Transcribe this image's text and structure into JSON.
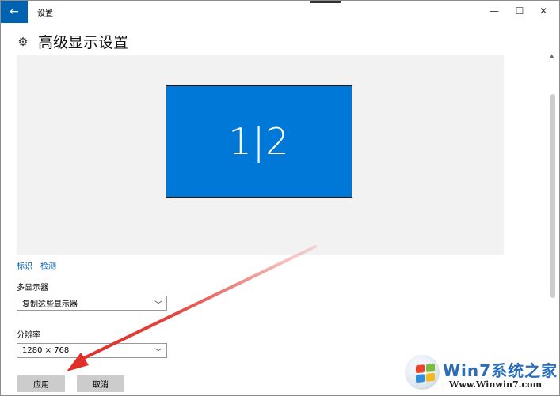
{
  "window": {
    "title": "设置",
    "back_icon": "←",
    "minimize_icon": "—",
    "maximize_icon": "☐",
    "close_icon": "✕"
  },
  "page": {
    "title": "高级显示设置",
    "gear_icon": "⚙"
  },
  "preview": {
    "monitor_label": "1|2",
    "monitor_color": "#0078d7"
  },
  "links": {
    "identify": "标识",
    "detect": "检测"
  },
  "multi_display": {
    "label": "多显示器",
    "value": "复制这些显示器"
  },
  "resolution": {
    "label": "分辨率",
    "value": "1280 × 768"
  },
  "buttons": {
    "apply": "应用",
    "cancel": "取消"
  },
  "watermark": {
    "title": "Win7系统之家",
    "url": "Www.Winwin7.com"
  },
  "colors": {
    "accent": "#0063b1",
    "arrow": "#e0302a"
  }
}
